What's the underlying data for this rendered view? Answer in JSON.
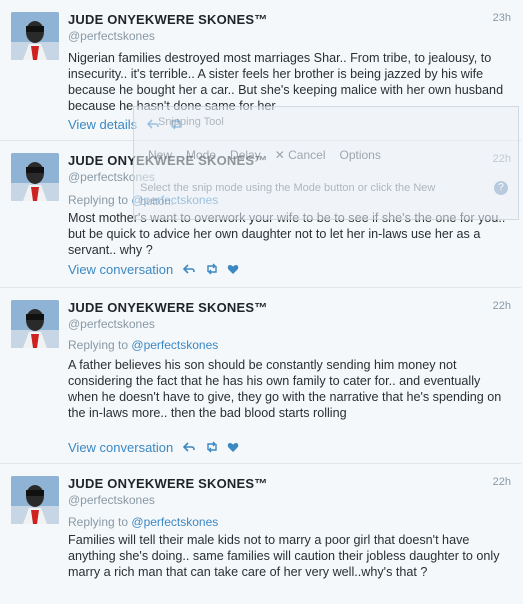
{
  "tweets": [
    {
      "name": "JUDE ONYEKWERE SKONES™",
      "handle": "@perfectskones",
      "time": "23h",
      "replying_prefix": "",
      "replying_to": "",
      "text": "Nigerian families destroyed most marriages Shar.. From tribe, to jealousy, to insecurity.. it's terrible.. A sister feels her brother is being jazzed by his wife because he bought her a car.. But she's keeping malice with her own husband because he hasn't done same for her",
      "link_label": "View details"
    },
    {
      "name": "JUDE ONYEKWERE SKONES™",
      "handle": "@perfectskones",
      "time": "22h",
      "replying_prefix": "Replying to",
      "replying_to": "@perfectskones",
      "text": "Most mother's want to overwork your wife to be to see if she's the one for you.. but be quick to advice her own daughter not to let her in-laws use her as a servant.. why ?",
      "link_label": "View conversation"
    },
    {
      "name": "JUDE ONYEKWERE SKONES™",
      "handle": "@perfectskones",
      "time": "22h",
      "replying_prefix": "Replying to",
      "replying_to": "@perfectskones",
      "text": "A father believes his son should be constantly sending him money not considering the fact that he has his own family to cater for.. and eventually when he doesn't have to give, they go with the narrative that he's spending on the in-laws more.. then the bad blood starts rolling",
      "link_label": "View conversation"
    },
    {
      "name": "JUDE ONYEKWERE SKONES™",
      "handle": "@perfectskones",
      "time": "22h",
      "replying_prefix": "Replying to",
      "replying_to": "@perfectskones",
      "text": "Families will tell their male kids not to marry a poor girl that doesn't have anything she's doing.. same families will caution their jobless daughter to only marry a rich man that can take care of her very well..why's that ?",
      "link_label": ""
    }
  ],
  "snipping_tool": {
    "title": "Snipping Tool",
    "new_label": "New",
    "mode_label": "Mode",
    "delay_label": "Delay",
    "cancel_label": "Cancel",
    "options_label": "Options",
    "hint": "Select the snip mode using the Mode button or click the New button."
  },
  "colors": {
    "link": "#3b88c3",
    "muted": "#8899a6",
    "background": "#f5f8fa"
  }
}
